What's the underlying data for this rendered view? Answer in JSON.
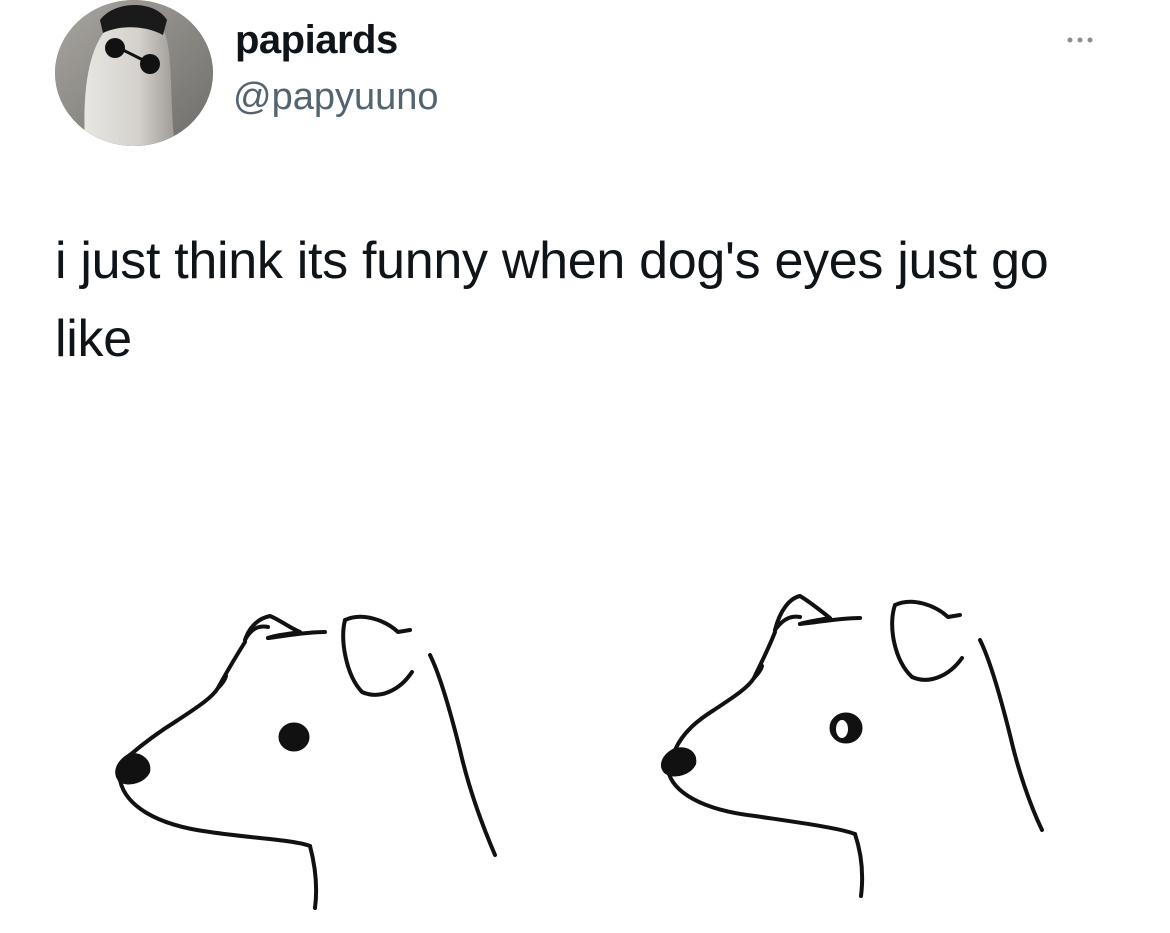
{
  "tweet": {
    "display_name": "papiards",
    "handle": "@papyuuno",
    "text": "i just think its funny when dog's eyes just go like",
    "more_icon": "more-horizontal-icon",
    "avatar_description_icon": "ghost-avatar-icon"
  },
  "media": {
    "panels": [
      {
        "eye_style": "solid-black"
      },
      {
        "eye_style": "hollow-highlight"
      }
    ]
  },
  "colors": {
    "background": "#ffffff",
    "text_primary": "#0f1419",
    "text_secondary": "#536471"
  }
}
